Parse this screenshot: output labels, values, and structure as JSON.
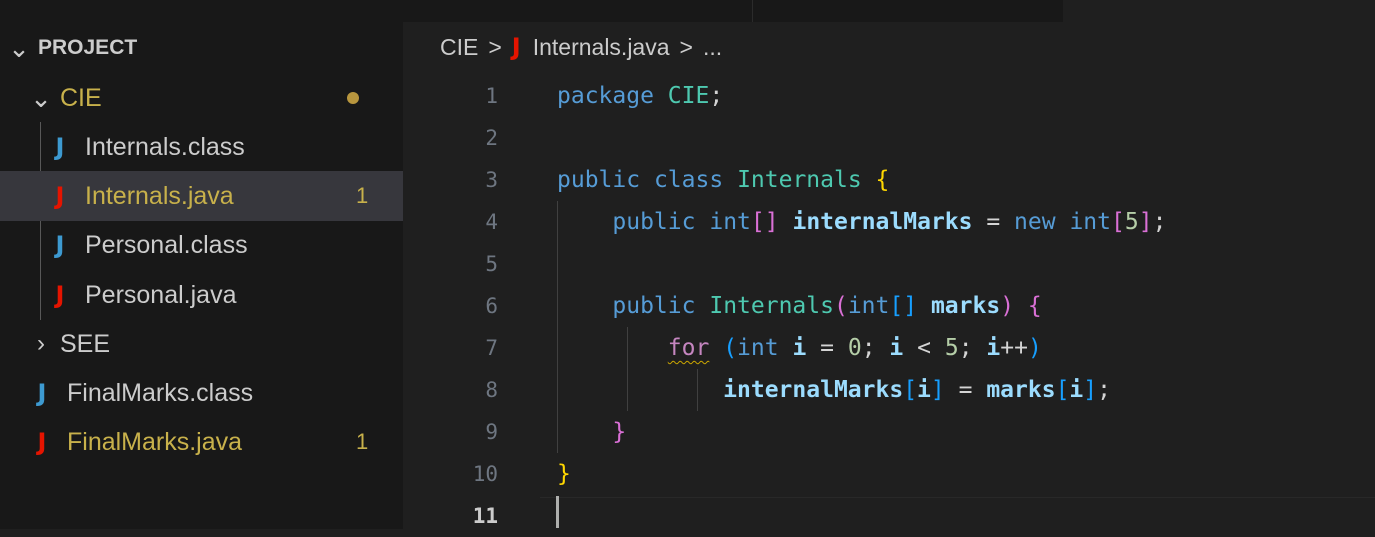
{
  "explorer": {
    "section_chevron": "expanded",
    "section_title": "PROJECT",
    "items": [
      {
        "kind": "folder",
        "label": "CIE",
        "expanded": true,
        "modified_dot": true
      },
      {
        "kind": "file",
        "icon": "J",
        "icon_color": "#3d9ad1",
        "label": "Internals.class"
      },
      {
        "kind": "file",
        "icon": "J",
        "icon_color": "#e51400",
        "label": "Internals.java",
        "badge": "1",
        "selected": true
      },
      {
        "kind": "file",
        "icon": "J",
        "icon_color": "#3d9ad1",
        "label": "Personal.class"
      },
      {
        "kind": "file",
        "icon": "J",
        "icon_color": "#e51400",
        "label": "Personal.java"
      },
      {
        "kind": "folder",
        "label": "SEE",
        "expanded": false
      },
      {
        "kind": "file",
        "icon": "J",
        "icon_color": "#3d9ad1",
        "label": "FinalMarks.class"
      },
      {
        "kind": "file",
        "icon": "J",
        "icon_color": "#e51400",
        "label": "FinalMarks.java",
        "badge": "1"
      }
    ]
  },
  "breadcrumb": {
    "folder": "CIE",
    "sep": ">",
    "file_icon": "J",
    "file": "Internals.java",
    "more": "..."
  },
  "editor": {
    "line_numbers": [
      "1",
      "2",
      "3",
      "4",
      "5",
      "6",
      "7",
      "8",
      "9",
      "10",
      "11"
    ],
    "active_line": "11",
    "lines": [
      "package CIE;",
      "",
      "public class Internals {",
      "    public int[] internalMarks = new int[5];",
      "",
      "    public Internals(int[] marks) {",
      "        for (int i = 0; i < 5; i++)",
      "            internalMarks[i] = marks[i];",
      "    }",
      "}",
      ""
    ],
    "warning_token": "for"
  },
  "colors": {
    "sidebar_bg": "#181818",
    "editor_bg": "#1f1f1f",
    "selection_bg": "#37373d",
    "modified_yellow": "#c8b14b",
    "error_red": "#e51400",
    "keyword_blue": "#569cd6",
    "control_purple": "#c586c0",
    "type_teal": "#4ec9b0",
    "field_lightblue": "#9cdcfe"
  }
}
